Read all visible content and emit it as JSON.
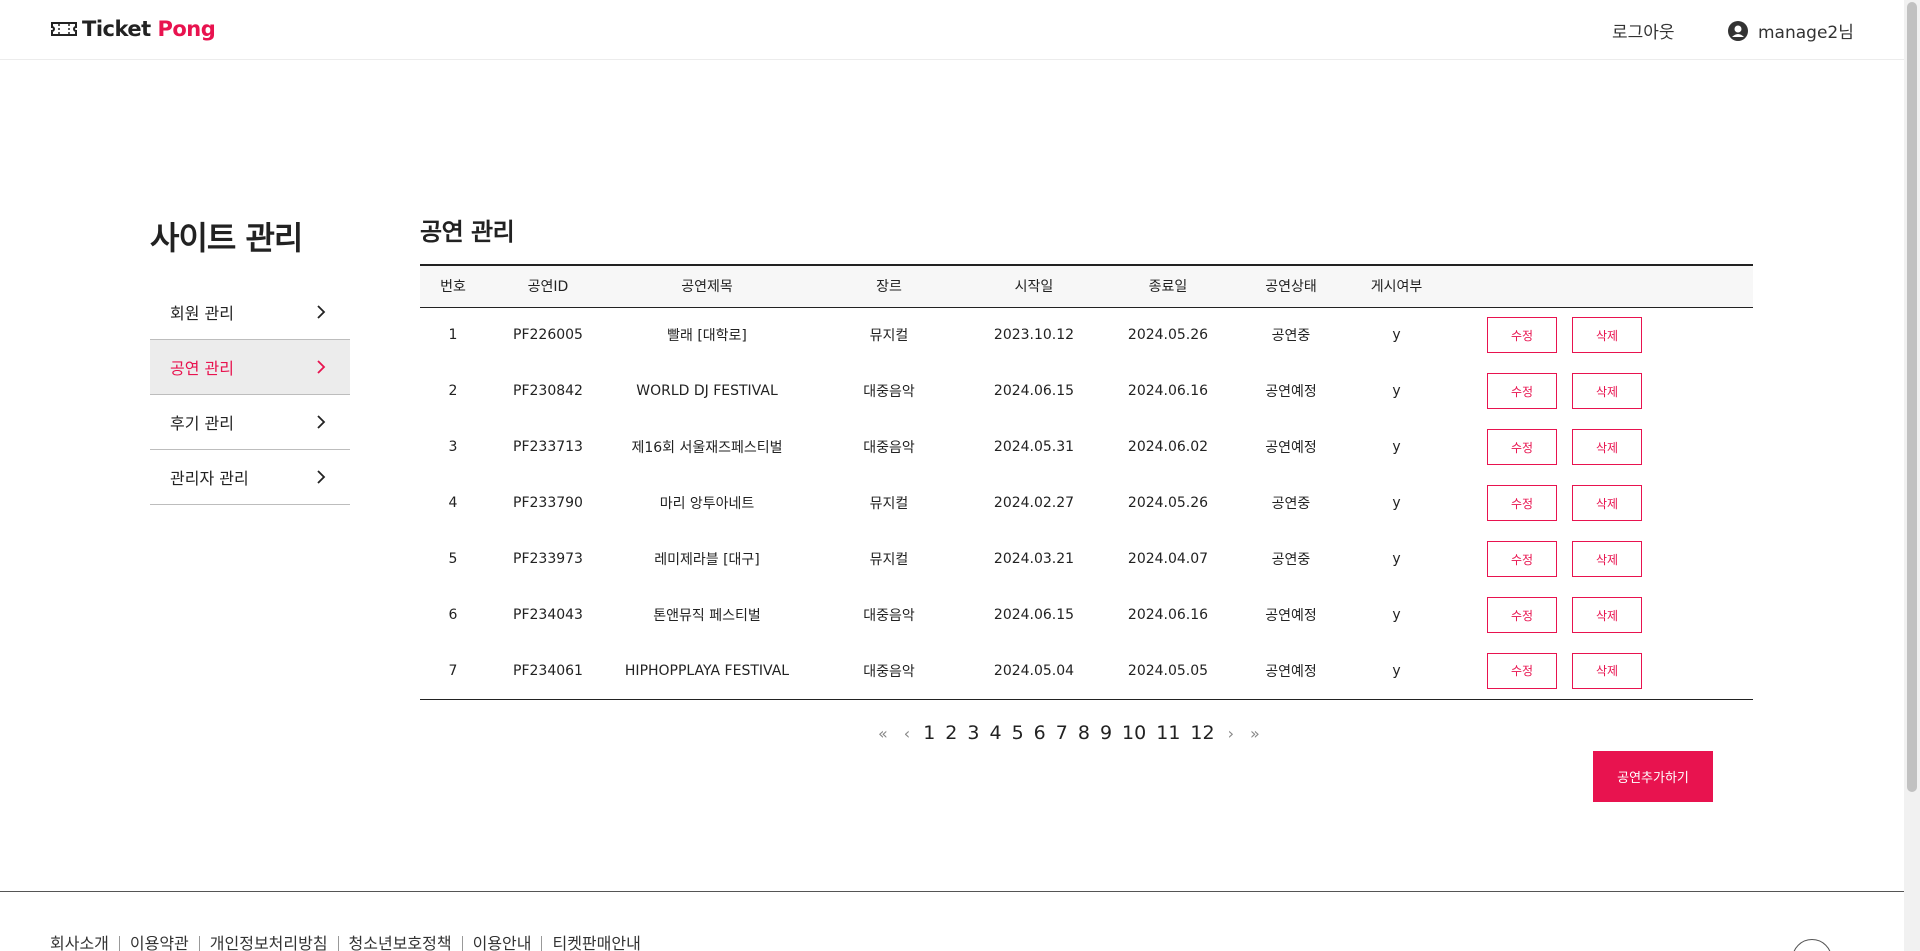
{
  "header": {
    "logo_text_1": "Ticket",
    "logo_text_2": "Pong",
    "logout_label": "로그아웃",
    "username": "manage2님"
  },
  "sidebar": {
    "title": "사이트 관리",
    "items": [
      {
        "label": "회원 관리",
        "active": false
      },
      {
        "label": "공연 관리",
        "active": true
      },
      {
        "label": "후기 관리",
        "active": false
      },
      {
        "label": "관리자 관리",
        "active": false
      }
    ]
  },
  "main": {
    "title": "공연 관리",
    "columns": [
      "번호",
      "공연ID",
      "공연제목",
      "장르",
      "시작일",
      "종료일",
      "공연상태",
      "게시여부"
    ],
    "rows": [
      [
        "1",
        "PF226005",
        "빨래 [대학로]",
        "뮤지컬",
        "2023.10.12",
        "2024.05.26",
        "공연중",
        "y"
      ],
      [
        "2",
        "PF230842",
        "WORLD DJ FESTIVAL",
        "대중음악",
        "2024.06.15",
        "2024.06.16",
        "공연예정",
        "y"
      ],
      [
        "3",
        "PF233713",
        "제16회 서울재즈페스티벌",
        "대중음악",
        "2024.05.31",
        "2024.06.02",
        "공연예정",
        "y"
      ],
      [
        "4",
        "PF233790",
        "마리 앙투아네트",
        "뮤지컬",
        "2024.02.27",
        "2024.05.26",
        "공연중",
        "y"
      ],
      [
        "5",
        "PF233973",
        "레미제라블 [대구]",
        "뮤지컬",
        "2024.03.21",
        "2024.04.07",
        "공연중",
        "y"
      ],
      [
        "6",
        "PF234043",
        "톤앤뮤직 페스티벌",
        "대중음악",
        "2024.06.15",
        "2024.06.16",
        "공연예정",
        "y"
      ],
      [
        "7",
        "PF234061",
        "HIPHOPPLAYA FESTIVAL",
        "대중음악",
        "2024.05.04",
        "2024.05.05",
        "공연예정",
        "y"
      ]
    ],
    "edit_label": "수정",
    "delete_label": "삭제",
    "add_label": "공연추가하기"
  },
  "pagination": {
    "first": "«",
    "prev": "‹",
    "pages": [
      "1",
      "2",
      "3",
      "4",
      "5",
      "6",
      "7",
      "8",
      "9",
      "10",
      "11",
      "12"
    ],
    "next": "›",
    "last": "»"
  },
  "footer": {
    "links": [
      "회사소개",
      "이용약관",
      "개인정보처리방침",
      "청소년보호정책",
      "이용안내",
      "티켓판매안내"
    ]
  },
  "colors": {
    "accent": "#e8134f",
    "active_bg": "#ececec"
  }
}
